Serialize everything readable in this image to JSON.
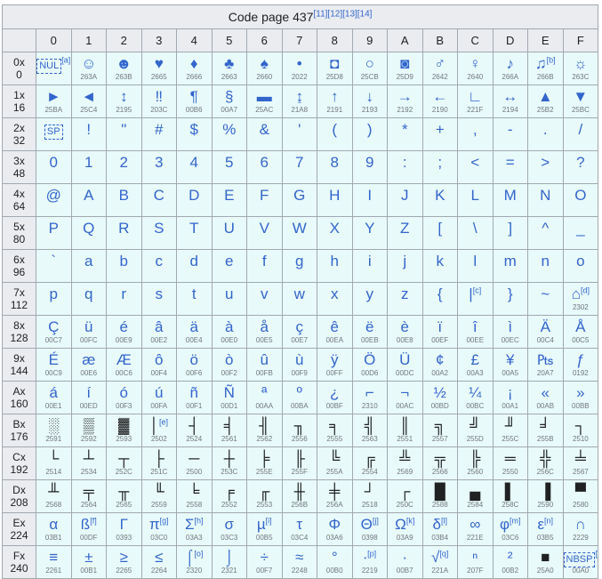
{
  "caption": "Code page 437",
  "caption_refs": "[11][12][13][14]",
  "columns": [
    "0",
    "1",
    "2",
    "3",
    "4",
    "5",
    "6",
    "7",
    "8",
    "9",
    "A",
    "B",
    "C",
    "D",
    "E",
    "F"
  ],
  "rows": [
    {
      "h1": "0x",
      "h2": "0",
      "cells": [
        {
          "g": "NUL",
          "box": true,
          "sup": "[a]",
          "u": ""
        },
        {
          "g": "☺",
          "u": "263A"
        },
        {
          "g": "☻",
          "u": "263B"
        },
        {
          "g": "♥",
          "u": "2665"
        },
        {
          "g": "♦",
          "u": "2666"
        },
        {
          "g": "♣",
          "u": "2663"
        },
        {
          "g": "♠",
          "u": "2660"
        },
        {
          "g": "•",
          "u": "2022"
        },
        {
          "g": "◘",
          "u": "25D8"
        },
        {
          "g": "○",
          "u": "25CB"
        },
        {
          "g": "◙",
          "u": "25D9"
        },
        {
          "g": "♂",
          "u": "2642"
        },
        {
          "g": "♀",
          "u": "2640"
        },
        {
          "g": "♪",
          "u": "266A"
        },
        {
          "g": "♫",
          "sup": "[b]",
          "u": "266B"
        },
        {
          "g": "☼",
          "u": "263C"
        }
      ]
    },
    {
      "h1": "1x",
      "h2": "16",
      "cells": [
        {
          "g": "►",
          "u": "25BA"
        },
        {
          "g": "◄",
          "u": "25C4"
        },
        {
          "g": "↕",
          "u": "2195"
        },
        {
          "g": "‼",
          "u": "203C"
        },
        {
          "g": "¶",
          "u": "00B6"
        },
        {
          "g": "§",
          "u": "00A7"
        },
        {
          "g": "▬",
          "u": "25AC"
        },
        {
          "g": "↨",
          "u": "21A8"
        },
        {
          "g": "↑",
          "u": "2191"
        },
        {
          "g": "↓",
          "u": "2193"
        },
        {
          "g": "→",
          "u": "2192"
        },
        {
          "g": "←",
          "u": "2190"
        },
        {
          "g": "∟",
          "u": "221F"
        },
        {
          "g": "↔",
          "u": "2194"
        },
        {
          "g": "▲",
          "u": "25B2"
        },
        {
          "g": "▼",
          "u": "25BC"
        }
      ]
    },
    {
      "h1": "2x",
      "h2": "32",
      "cells": [
        {
          "g": "SP",
          "box": true,
          "u": ""
        },
        {
          "g": "!",
          "u": ""
        },
        {
          "g": "\"",
          "u": ""
        },
        {
          "g": "#",
          "u": ""
        },
        {
          "g": "$",
          "u": ""
        },
        {
          "g": "%",
          "u": ""
        },
        {
          "g": "&",
          "u": ""
        },
        {
          "g": "'",
          "u": ""
        },
        {
          "g": "(",
          "u": ""
        },
        {
          "g": ")",
          "u": ""
        },
        {
          "g": "*",
          "u": ""
        },
        {
          "g": "+",
          "u": ""
        },
        {
          "g": ",",
          "u": ""
        },
        {
          "g": "-",
          "u": ""
        },
        {
          "g": ".",
          "u": ""
        },
        {
          "g": "/",
          "u": ""
        }
      ]
    },
    {
      "h1": "3x",
      "h2": "48",
      "cells": [
        {
          "g": "0",
          "u": ""
        },
        {
          "g": "1",
          "u": ""
        },
        {
          "g": "2",
          "u": ""
        },
        {
          "g": "3",
          "u": ""
        },
        {
          "g": "4",
          "u": ""
        },
        {
          "g": "5",
          "u": ""
        },
        {
          "g": "6",
          "u": ""
        },
        {
          "g": "7",
          "u": ""
        },
        {
          "g": "8",
          "u": ""
        },
        {
          "g": "9",
          "u": ""
        },
        {
          "g": ":",
          "u": ""
        },
        {
          "g": ";",
          "u": ""
        },
        {
          "g": "<",
          "u": ""
        },
        {
          "g": "=",
          "u": ""
        },
        {
          "g": ">",
          "u": ""
        },
        {
          "g": "?",
          "u": ""
        }
      ]
    },
    {
      "h1": "4x",
      "h2": "64",
      "cells": [
        {
          "g": "@",
          "u": ""
        },
        {
          "g": "A",
          "u": ""
        },
        {
          "g": "B",
          "u": ""
        },
        {
          "g": "C",
          "u": ""
        },
        {
          "g": "D",
          "u": ""
        },
        {
          "g": "E",
          "u": ""
        },
        {
          "g": "F",
          "u": ""
        },
        {
          "g": "G",
          "u": ""
        },
        {
          "g": "H",
          "u": ""
        },
        {
          "g": "I",
          "u": ""
        },
        {
          "g": "J",
          "u": ""
        },
        {
          "g": "K",
          "u": ""
        },
        {
          "g": "L",
          "u": ""
        },
        {
          "g": "M",
          "u": ""
        },
        {
          "g": "N",
          "u": ""
        },
        {
          "g": "O",
          "u": ""
        }
      ]
    },
    {
      "h1": "5x",
      "h2": "80",
      "cells": [
        {
          "g": "P",
          "u": ""
        },
        {
          "g": "Q",
          "u": ""
        },
        {
          "g": "R",
          "u": ""
        },
        {
          "g": "S",
          "u": ""
        },
        {
          "g": "T",
          "u": ""
        },
        {
          "g": "U",
          "u": ""
        },
        {
          "g": "V",
          "u": ""
        },
        {
          "g": "W",
          "u": ""
        },
        {
          "g": "X",
          "u": ""
        },
        {
          "g": "Y",
          "u": ""
        },
        {
          "g": "Z",
          "u": ""
        },
        {
          "g": "[",
          "u": ""
        },
        {
          "g": "\\",
          "u": ""
        },
        {
          "g": "]",
          "u": ""
        },
        {
          "g": "^",
          "u": ""
        },
        {
          "g": "_",
          "u": ""
        }
      ]
    },
    {
      "h1": "6x",
      "h2": "96",
      "cells": [
        {
          "g": "`",
          "u": ""
        },
        {
          "g": "a",
          "u": ""
        },
        {
          "g": "b",
          "u": ""
        },
        {
          "g": "c",
          "u": ""
        },
        {
          "g": "d",
          "u": ""
        },
        {
          "g": "e",
          "u": ""
        },
        {
          "g": "f",
          "u": ""
        },
        {
          "g": "g",
          "u": ""
        },
        {
          "g": "h",
          "u": ""
        },
        {
          "g": "i",
          "u": ""
        },
        {
          "g": "j",
          "u": ""
        },
        {
          "g": "k",
          "u": ""
        },
        {
          "g": "l",
          "u": ""
        },
        {
          "g": "m",
          "u": ""
        },
        {
          "g": "n",
          "u": ""
        },
        {
          "g": "o",
          "u": ""
        }
      ]
    },
    {
      "h1": "7x",
      "h2": "112",
      "cells": [
        {
          "g": "p",
          "u": ""
        },
        {
          "g": "q",
          "u": ""
        },
        {
          "g": "r",
          "u": ""
        },
        {
          "g": "s",
          "u": ""
        },
        {
          "g": "t",
          "u": ""
        },
        {
          "g": "u",
          "u": ""
        },
        {
          "g": "v",
          "u": ""
        },
        {
          "g": "w",
          "u": ""
        },
        {
          "g": "x",
          "u": ""
        },
        {
          "g": "y",
          "u": ""
        },
        {
          "g": "z",
          "u": ""
        },
        {
          "g": "{",
          "u": ""
        },
        {
          "g": "|",
          "sup": "[c]",
          "u": ""
        },
        {
          "g": "}",
          "u": ""
        },
        {
          "g": "~",
          "u": ""
        },
        {
          "g": "⌂",
          "sup": "[d]",
          "u": "2302"
        }
      ]
    },
    {
      "h1": "8x",
      "h2": "128",
      "cells": [
        {
          "g": "Ç",
          "u": "00C7"
        },
        {
          "g": "ü",
          "u": "00FC"
        },
        {
          "g": "é",
          "u": "00E9"
        },
        {
          "g": "â",
          "u": "00E2"
        },
        {
          "g": "ä",
          "u": "00E4"
        },
        {
          "g": "à",
          "u": "00E0"
        },
        {
          "g": "å",
          "u": "00E5"
        },
        {
          "g": "ç",
          "u": "00E7"
        },
        {
          "g": "ê",
          "u": "00EA"
        },
        {
          "g": "ë",
          "u": "00EB"
        },
        {
          "g": "è",
          "u": "00E8"
        },
        {
          "g": "ï",
          "u": "00EF"
        },
        {
          "g": "î",
          "u": "00EE"
        },
        {
          "g": "ì",
          "u": "00EC"
        },
        {
          "g": "Ä",
          "u": "00C4"
        },
        {
          "g": "Å",
          "u": "00C5"
        }
      ]
    },
    {
      "h1": "9x",
      "h2": "144",
      "cells": [
        {
          "g": "É",
          "u": "00C9"
        },
        {
          "g": "æ",
          "u": "00E6"
        },
        {
          "g": "Æ",
          "u": "00C6"
        },
        {
          "g": "ô",
          "u": "00F4"
        },
        {
          "g": "ö",
          "u": "00F6"
        },
        {
          "g": "ò",
          "u": "00F2"
        },
        {
          "g": "û",
          "u": "00FB"
        },
        {
          "g": "ù",
          "u": "00F9"
        },
        {
          "g": "ÿ",
          "u": "00FF"
        },
        {
          "g": "Ö",
          "u": "00D6"
        },
        {
          "g": "Ü",
          "u": "00DC"
        },
        {
          "g": "¢",
          "u": "00A2"
        },
        {
          "g": "£",
          "u": "00A3"
        },
        {
          "g": "¥",
          "u": "00A5"
        },
        {
          "g": "₧",
          "u": "20A7"
        },
        {
          "g": "ƒ",
          "u": "0192"
        }
      ]
    },
    {
      "h1": "Ax",
      "h2": "160",
      "cells": [
        {
          "g": "á",
          "u": "00E1"
        },
        {
          "g": "í",
          "u": "00ED"
        },
        {
          "g": "ó",
          "u": "00F3"
        },
        {
          "g": "ú",
          "u": "00FA"
        },
        {
          "g": "ñ",
          "u": "00F1"
        },
        {
          "g": "Ñ",
          "u": "00D1"
        },
        {
          "g": "ª",
          "u": "00AA"
        },
        {
          "g": "º",
          "u": "00BA"
        },
        {
          "g": "¿",
          "u": "00BF"
        },
        {
          "g": "⌐",
          "u": "2310"
        },
        {
          "g": "¬",
          "u": "00AC"
        },
        {
          "g": "½",
          "u": "00BD"
        },
        {
          "g": "¼",
          "u": "00BC"
        },
        {
          "g": "¡",
          "u": "00A1"
        },
        {
          "g": "«",
          "u": "00AB"
        },
        {
          "g": "»",
          "u": "00BB"
        }
      ]
    },
    {
      "h1": "Bx",
      "h2": "176",
      "cells": [
        {
          "g": "░",
          "u": "2591",
          "dark": true
        },
        {
          "g": "▒",
          "u": "2592",
          "dark": true
        },
        {
          "g": "▓",
          "u": "2593",
          "dark": true
        },
        {
          "g": "│",
          "sup": "[e]",
          "u": "2502",
          "dark": true
        },
        {
          "g": "┤",
          "u": "2524",
          "dark": true
        },
        {
          "g": "╡",
          "u": "2561",
          "dark": true
        },
        {
          "g": "╢",
          "u": "2562",
          "dark": true
        },
        {
          "g": "╖",
          "u": "2556",
          "dark": true
        },
        {
          "g": "╕",
          "u": "2555",
          "dark": true
        },
        {
          "g": "╣",
          "u": "2563",
          "dark": true
        },
        {
          "g": "║",
          "u": "2551",
          "dark": true
        },
        {
          "g": "╗",
          "u": "2557",
          "dark": true
        },
        {
          "g": "╝",
          "u": "255D",
          "dark": true
        },
        {
          "g": "╜",
          "u": "255C",
          "dark": true
        },
        {
          "g": "╛",
          "u": "255B",
          "dark": true
        },
        {
          "g": "┐",
          "u": "2510",
          "dark": true
        }
      ]
    },
    {
      "h1": "Cx",
      "h2": "192",
      "cells": [
        {
          "g": "└",
          "u": "2514",
          "dark": true
        },
        {
          "g": "┴",
          "u": "2534",
          "dark": true
        },
        {
          "g": "┬",
          "u": "252C",
          "dark": true
        },
        {
          "g": "├",
          "u": "251C",
          "dark": true
        },
        {
          "g": "─",
          "u": "2500",
          "dark": true
        },
        {
          "g": "┼",
          "u": "253C",
          "dark": true
        },
        {
          "g": "╞",
          "u": "255E",
          "dark": true
        },
        {
          "g": "╟",
          "u": "255F",
          "dark": true
        },
        {
          "g": "╚",
          "u": "255A",
          "dark": true
        },
        {
          "g": "╔",
          "u": "2554",
          "dark": true
        },
        {
          "g": "╩",
          "u": "2569",
          "dark": true
        },
        {
          "g": "╦",
          "u": "2566",
          "dark": true
        },
        {
          "g": "╠",
          "u": "2560",
          "dark": true
        },
        {
          "g": "═",
          "u": "2550",
          "dark": true
        },
        {
          "g": "╬",
          "u": "256C",
          "dark": true
        },
        {
          "g": "╧",
          "u": "2567",
          "dark": true
        }
      ]
    },
    {
      "h1": "Dx",
      "h2": "208",
      "cells": [
        {
          "g": "╨",
          "u": "2568",
          "dark": true
        },
        {
          "g": "╤",
          "u": "2564",
          "dark": true
        },
        {
          "g": "╥",
          "u": "2565",
          "dark": true
        },
        {
          "g": "╙",
          "u": "2559",
          "dark": true
        },
        {
          "g": "╘",
          "u": "2558",
          "dark": true
        },
        {
          "g": "╒",
          "u": "2552",
          "dark": true
        },
        {
          "g": "╓",
          "u": "2553",
          "dark": true
        },
        {
          "g": "╫",
          "u": "256B",
          "dark": true
        },
        {
          "g": "╪",
          "u": "256A",
          "dark": true
        },
        {
          "g": "┘",
          "u": "2518",
          "dark": true
        },
        {
          "g": "┌",
          "u": "250C",
          "dark": true
        },
        {
          "g": "█",
          "u": "2588",
          "dark": true
        },
        {
          "g": "▄",
          "u": "2584",
          "dark": true
        },
        {
          "g": "▌",
          "u": "258C",
          "dark": true
        },
        {
          "g": "▐",
          "u": "2590",
          "dark": true
        },
        {
          "g": "▀",
          "u": "2580",
          "dark": true
        }
      ]
    },
    {
      "h1": "Ex",
      "h2": "224",
      "cells": [
        {
          "g": "α",
          "u": "03B1"
        },
        {
          "g": "ß",
          "sup": "[f]",
          "u": "00DF"
        },
        {
          "g": "Γ",
          "u": "0393"
        },
        {
          "g": "π",
          "sup": "[g]",
          "u": "03C0"
        },
        {
          "g": "Σ",
          "sup": "[h]",
          "u": "03A3"
        },
        {
          "g": "σ",
          "u": "03C3"
        },
        {
          "g": "µ",
          "sup": "[i]",
          "u": "00B5"
        },
        {
          "g": "τ",
          "u": "03C4"
        },
        {
          "g": "Φ",
          "u": "03A6"
        },
        {
          "g": "Θ",
          "sup": "[j]",
          "u": "0398"
        },
        {
          "g": "Ω",
          "sup": "[k]",
          "u": "03A9"
        },
        {
          "g": "δ",
          "sup": "[l]",
          "u": "03B4"
        },
        {
          "g": "∞",
          "u": "221E"
        },
        {
          "g": "φ",
          "sup": "[m]",
          "u": "03C6"
        },
        {
          "g": "ε",
          "sup": "[n]",
          "u": "03B5"
        },
        {
          "g": "∩",
          "u": "2229"
        }
      ]
    },
    {
      "h1": "Fx",
      "h2": "240",
      "cells": [
        {
          "g": "≡",
          "u": "2261"
        },
        {
          "g": "±",
          "u": "00B1"
        },
        {
          "g": "≥",
          "u": "2265"
        },
        {
          "g": "≤",
          "u": "2264"
        },
        {
          "g": "⌠",
          "sup": "[o]",
          "u": "2320"
        },
        {
          "g": "⌡",
          "u": "2321"
        },
        {
          "g": "÷",
          "u": "00F7"
        },
        {
          "g": "≈",
          "u": "2248"
        },
        {
          "g": "°",
          "u": "00B0"
        },
        {
          "g": "∙",
          "sup": "[p]",
          "u": "2219"
        },
        {
          "g": "·",
          "u": "00B7"
        },
        {
          "g": "√",
          "sup": "[q]",
          "u": "221A"
        },
        {
          "g": "ⁿ",
          "u": "207F"
        },
        {
          "g": "²",
          "u": "00B2"
        },
        {
          "g": "■",
          "u": "25A0",
          "dark": true
        },
        {
          "g": "NBSP",
          "box": true,
          "sup": "[r]",
          "u": "00A0"
        }
      ]
    }
  ]
}
